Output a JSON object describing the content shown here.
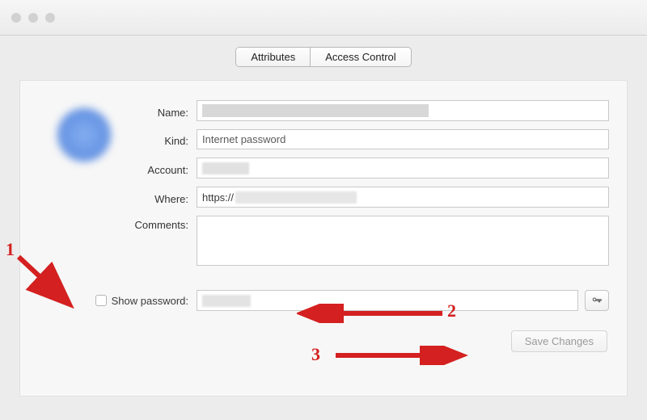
{
  "window": {
    "title": ""
  },
  "tabs": {
    "attributes": "Attributes",
    "access_control": "Access Control",
    "active": "attributes"
  },
  "fields": {
    "name": {
      "label": "Name:",
      "value": ""
    },
    "kind": {
      "label": "Kind:",
      "value": "Internet password"
    },
    "account": {
      "label": "Account:",
      "value": ""
    },
    "where": {
      "label": "Where:",
      "value_prefix": "https://"
    },
    "comments": {
      "label": "Comments:",
      "value": ""
    },
    "show_password": {
      "label": "Show password:",
      "checked": false,
      "value": ""
    }
  },
  "buttons": {
    "save_changes": "Save Changes"
  },
  "annotations": {
    "n1": "1",
    "n2": "2",
    "n3": "3"
  },
  "colors": {
    "accent_red": "#d42020"
  }
}
